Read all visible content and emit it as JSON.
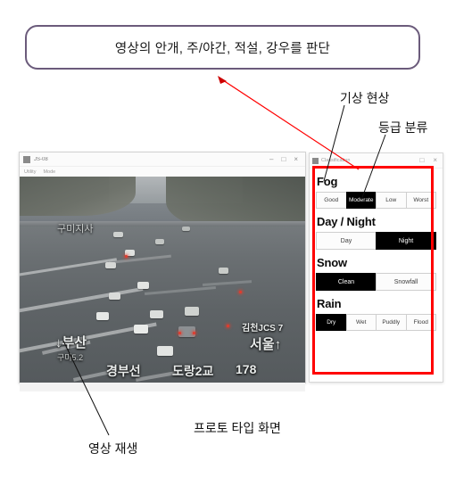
{
  "callout": {
    "text": "영상의 안개, 주/야간, 적설, 강우를 판단",
    "border_color": "#6B5B7B"
  },
  "annotations": {
    "weather_phenomenon": "기상 현상",
    "grade_classification": "등급 분류",
    "video_playback": "영상 재생",
    "prototype_screen": "프로토 타입 화면",
    "leader_line_color": "#111111",
    "pointer_line_color": "#ff0000",
    "highlight_box_color": "#ff0000"
  },
  "video_window": {
    "title": "JS-08",
    "menu": [
      "Utility",
      "Mode"
    ],
    "window_buttons": [
      "–",
      "□",
      "×"
    ],
    "overlay": {
      "office": "구미지사",
      "direction_down": "↓",
      "destination_down": "부산",
      "distance": "구미5.2",
      "route": "경부선",
      "bridge": "도랑2교",
      "marker": "178",
      "junction": "김천JCS 7",
      "destination_up": "서울",
      "direction_up": "↑"
    }
  },
  "panel_window": {
    "title": "Classification",
    "window_buttons": [
      "□",
      "×"
    ],
    "groups": [
      {
        "title": "Fog",
        "options": [
          "Good",
          "Moderate",
          "Low",
          "Worst"
        ],
        "selected": "Moderate"
      },
      {
        "title": "Day / Night",
        "options": [
          "Day",
          "Night"
        ],
        "selected": "Night"
      },
      {
        "title": "Snow",
        "options": [
          "Clean",
          "Snowfall"
        ],
        "selected": "Clean"
      },
      {
        "title": "Rain",
        "options": [
          "Dry",
          "Wet",
          "Puddly",
          "Flood"
        ],
        "selected": "Dry"
      }
    ]
  }
}
